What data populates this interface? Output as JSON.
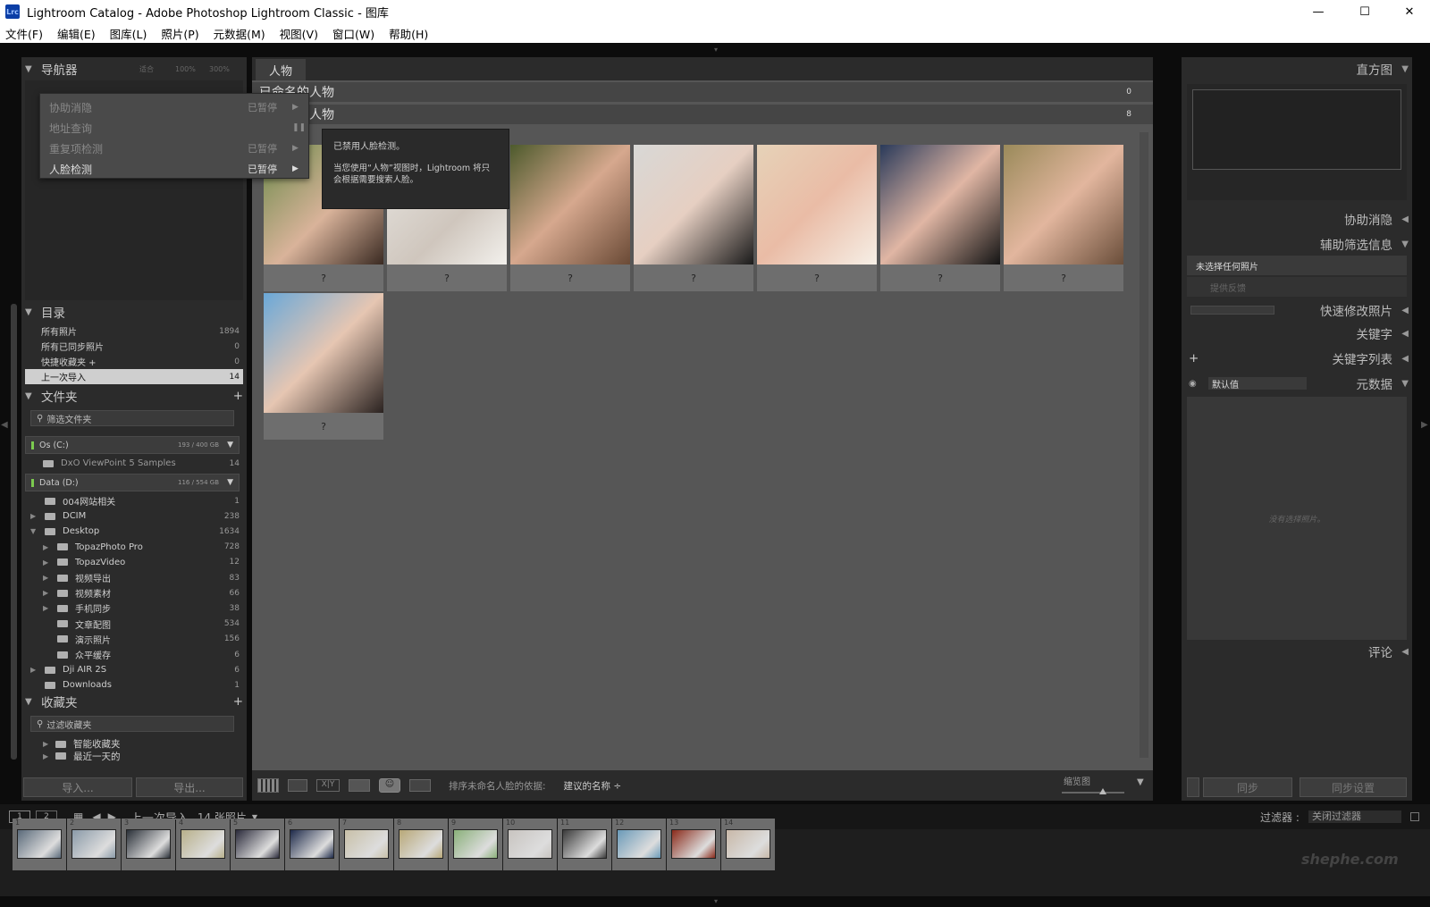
{
  "window": {
    "title": "Lightroom Catalog - Adobe Photoshop Lightroom Classic - 图库",
    "logo": "Lrc",
    "minimize": "—",
    "maximize": "☐",
    "close": "✕"
  },
  "menu": [
    "文件(F)",
    "编辑(E)",
    "图库(L)",
    "照片(P)",
    "元数据(M)",
    "视图(V)",
    "窗口(W)",
    "帮助(H)"
  ],
  "navigator": {
    "title": "导航器",
    "zoom": [
      "适合",
      "100%",
      "300%"
    ]
  },
  "context_menu": {
    "items": [
      {
        "label": "协助消隐",
        "status": "已暂停"
      },
      {
        "label": "地址查询",
        "status": ""
      },
      {
        "label": "重复项检测",
        "status": "已暂停"
      },
      {
        "label": "人脸检测",
        "status": "已暂停"
      }
    ],
    "tooltip_title": "已禁用人脸检测。",
    "tooltip_body": "当您使用“人物”视图时，Lightroom 将只会根据需要搜索人脸。"
  },
  "catalog": {
    "title": "目录",
    "items": [
      {
        "label": "所有照片",
        "count": "1894"
      },
      {
        "label": "所有已同步照片",
        "count": "0"
      },
      {
        "label": "快捷收藏夹 +",
        "count": "0"
      },
      {
        "label": "上一次导入",
        "count": "14"
      }
    ]
  },
  "folders": {
    "title": "文件夹",
    "add": "+",
    "search": "筛选文件夹",
    "volumes": [
      {
        "name": "Os (C:)",
        "size": "193 / 400 GB"
      },
      {
        "name": "Data (D:)",
        "size": "116 / 554 GB"
      }
    ],
    "c_items": [
      {
        "label": "DxO ViewPoint 5 Samples",
        "count": "14"
      }
    ],
    "d_items": [
      {
        "label": "004网站相关",
        "count": "1",
        "level": 0,
        "tri": ""
      },
      {
        "label": "DCIM",
        "count": "238",
        "level": 0,
        "tri": "▶"
      },
      {
        "label": "Desktop",
        "count": "1634",
        "level": 0,
        "tri": "▼"
      },
      {
        "label": "TopazPhoto Pro",
        "count": "728",
        "level": 1,
        "tri": "▶"
      },
      {
        "label": "TopazVideo",
        "count": "12",
        "level": 1,
        "tri": "▶"
      },
      {
        "label": "视频导出",
        "count": "83",
        "level": 1,
        "tri": "▶"
      },
      {
        "label": "视频素材",
        "count": "66",
        "level": 1,
        "tri": "▶"
      },
      {
        "label": "手机同步",
        "count": "38",
        "level": 1,
        "tri": "▶"
      },
      {
        "label": "文章配图",
        "count": "534",
        "level": 1,
        "tri": ""
      },
      {
        "label": "演示照片",
        "count": "156",
        "level": 1,
        "tri": ""
      },
      {
        "label": "众平缓存",
        "count": "6",
        "level": 1,
        "tri": ""
      },
      {
        "label": "Dji AIR 2S",
        "count": "6",
        "level": 0,
        "tri": "▶"
      },
      {
        "label": "Downloads",
        "count": "1",
        "level": 0,
        "tri": ""
      }
    ]
  },
  "collections": {
    "title": "收藏夹",
    "add": "+",
    "search": "过滤收藏夹",
    "items": [
      "智能收藏夹",
      "最近一天的"
    ]
  },
  "buttons": {
    "import": "导入...",
    "export": "导出..."
  },
  "people": {
    "tab": "人物",
    "named_title": "已命名的人物",
    "named_count": "0",
    "unnamed_title": "未命名的人物",
    "unnamed_count": "8",
    "face_label": "?"
  },
  "toolbar": {
    "sort_label": "排序未命名人脸的依据:",
    "sort_value": "建议的名称 ÷",
    "thumb_label": "缩览图"
  },
  "right": {
    "histogram": "直方图",
    "assist": "协助消隐",
    "filter_info": "辅助筛选信息",
    "no_selection": "未选择任何照片",
    "feedback": "提供反馈",
    "quick_dev": "快速修改照片",
    "keywords": "关键字",
    "keyword_list": "关键字列表",
    "metadata": "元数据",
    "meta_preset": "默认值",
    "no_photo": "没有选择照片。",
    "comments": "评论",
    "sync": "同步",
    "sync_settings": "同步设置"
  },
  "filmstrip": {
    "page1": "1",
    "page2": "2",
    "source": "上一次导入",
    "count": "14 张照片",
    "filter_label": "过滤器 :",
    "filter_value": "关闭过滤器",
    "watermark": "shephe.com",
    "numbers": [
      "1",
      "2",
      "3",
      "4",
      "5",
      "6",
      "7",
      "8",
      "9",
      "10",
      "11",
      "12",
      "13",
      "14"
    ]
  }
}
